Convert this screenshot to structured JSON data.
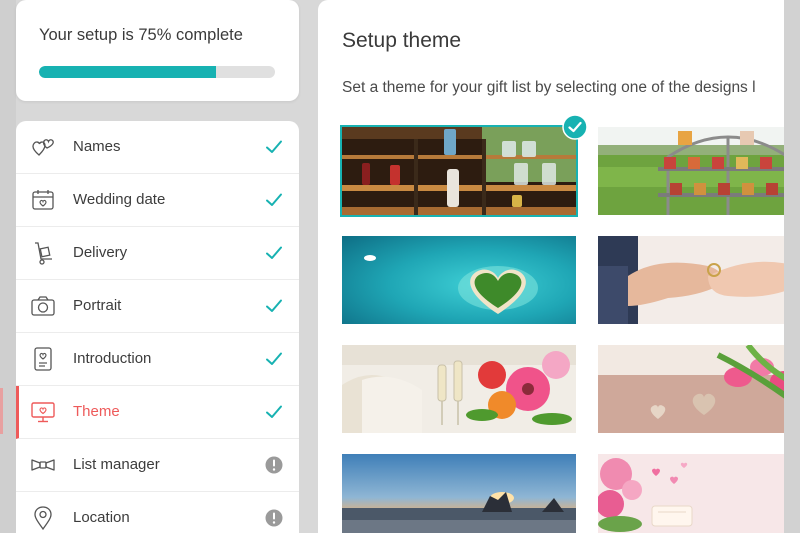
{
  "progress": {
    "text": "Your setup is 75% complete",
    "percent": 75
  },
  "steps": [
    {
      "label": "Names",
      "icon": "hearts-icon",
      "status": "complete"
    },
    {
      "label": "Wedding date",
      "icon": "calendar-icon",
      "status": "complete"
    },
    {
      "label": "Delivery",
      "icon": "delivery-trolley-icon",
      "status": "complete"
    },
    {
      "label": "Portrait",
      "icon": "camera-icon",
      "status": "complete"
    },
    {
      "label": "Introduction",
      "icon": "intro-card-icon",
      "status": "complete"
    },
    {
      "label": "Theme",
      "icon": "monitor-theme-icon",
      "status": "complete",
      "active": true
    },
    {
      "label": "List manager",
      "icon": "bow-tie-icon",
      "status": "incomplete"
    },
    {
      "label": "Location",
      "icon": "location-pin-icon",
      "status": "incomplete"
    }
  ],
  "main": {
    "title": "Setup theme",
    "subtitle": "Set a theme for your gift list by selecting one of the designs l",
    "themes": [
      {
        "name": "bar-shelves",
        "selected": true
      },
      {
        "name": "garden-cake-stand",
        "selected": false
      },
      {
        "name": "heart-island",
        "selected": false
      },
      {
        "name": "hands-ring",
        "selected": false
      },
      {
        "name": "champagne-flowers",
        "selected": false
      },
      {
        "name": "tulips-hearts",
        "selected": false
      },
      {
        "name": "sunset-beach",
        "selected": false
      },
      {
        "name": "roses-hearts",
        "selected": false
      }
    ]
  },
  "colors": {
    "accent": "#17b2b2",
    "active": "#ee5a5a",
    "pending": "#9a9a9a"
  }
}
